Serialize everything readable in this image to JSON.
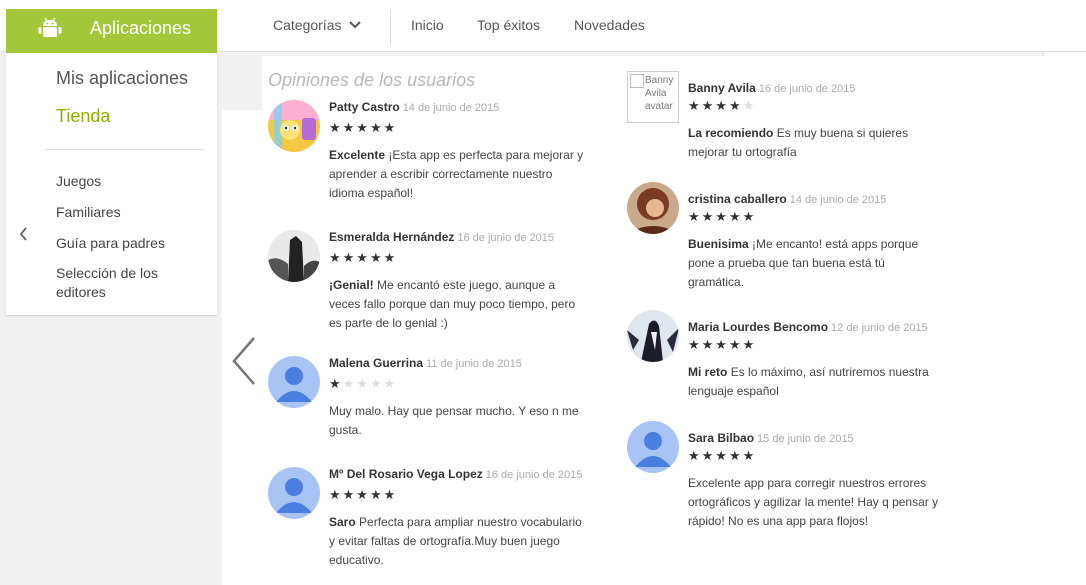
{
  "header": {
    "brand": "Aplicaciones",
    "categories": "Categorías",
    "nav": [
      "Inicio",
      "Top éxitos",
      "Novedades"
    ],
    "colors": {
      "brand": "#a4c639",
      "accent_text": "#8ab000",
      "default_avatar": "#a7c4f4"
    }
  },
  "sidebar": {
    "my_apps": "Mis aplicaciones",
    "store": "Tienda",
    "items": [
      "Juegos",
      "Familiares",
      "Guía para padres",
      "Selección de los editores"
    ]
  },
  "reviews_section": {
    "title": "Opiniones de los usuarios",
    "left": [
      {
        "name": "Patty Castro",
        "date": "14 de junio de 2015",
        "rating": 5,
        "headline": "Excelente",
        "text": "¡Esta app es perfecta para mejorar y aprender a escribir correctamente nuestro idioma español!",
        "avatar": "cartoon-avatar"
      },
      {
        "name": "Esmeralda Hernández",
        "date": "16 de junio de 2015",
        "rating": 5,
        "headline": "¡Genial!",
        "text": "Me encantó este juego, aunque a veces fallo porque dan muy poco tiempo, pero es parte de lo genial :)",
        "avatar": "photo-avatar"
      },
      {
        "name": "Malena Guerrina",
        "date": "11 de junio de 2015",
        "rating": 1,
        "headline": "",
        "text": "Muy malo. Hay que pensar mucho. Y eso n me gusta.",
        "avatar": "default-avatar"
      },
      {
        "name": "Mº Del Rosario Vega Lopez",
        "date": "16 de junio de 2015",
        "rating": 5,
        "headline": "Saro",
        "text": "Perfecta para ampliar nuestro vocabulario y evitar faltas de ortografía.Muy buen juego educativo.",
        "avatar": "default-avatar"
      }
    ],
    "right": [
      {
        "name": "Banny Avila",
        "date": "16 de junio de 2015",
        "rating": 4,
        "headline": "La recomiendo",
        "text": "Es muy buena si quieres mejorar tu ortografía",
        "avatar": "broken-image",
        "avatar_alt": "Banny Avila avatar"
      },
      {
        "name": "cristina caballero",
        "date": "14 de junio de 2015",
        "rating": 5,
        "headline": "Buenisima",
        "text": "¡Me encanto! está apps porque pone a prueba que tan buena está tú gramática.",
        "avatar": "photo-avatar"
      },
      {
        "name": "Maria Lourdes Bencomo",
        "date": "12 de junio de 2015",
        "rating": 5,
        "headline": "Mi reto",
        "text": "Es lo máximo, así nutriremos nuestra lenguaje español",
        "avatar": "photo-avatar"
      },
      {
        "name": "Sara Bilbao",
        "date": "15 de junio de 2015",
        "rating": 5,
        "headline": "",
        "text": "Excelente app para corregir nuestros errores ortográficos y agilizar la mente! Hay q pensar y rápido! No es una app para flojos!",
        "avatar": "default-avatar"
      }
    ]
  }
}
